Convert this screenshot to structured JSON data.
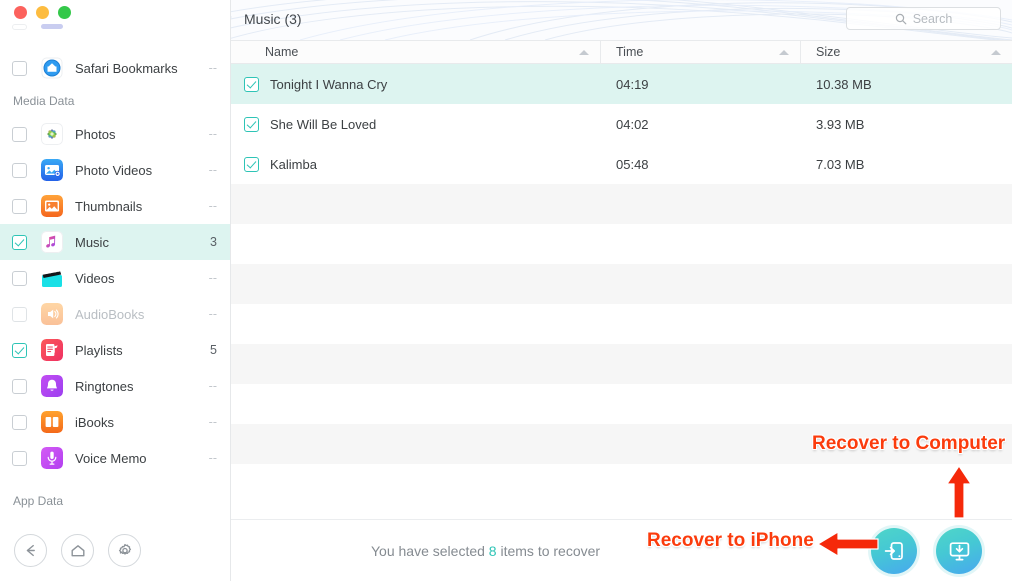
{
  "window": {
    "traffic_lights": [
      "close",
      "minimize",
      "maximize"
    ]
  },
  "sidebar": {
    "groups": [
      {
        "label": "",
        "items": [
          {
            "label": "Safari Bookmarks",
            "icon": "safari-bookmarks-icon",
            "count": "--",
            "checked": false,
            "selected": false,
            "dimmed": false
          }
        ]
      },
      {
        "label": "Media Data",
        "items": [
          {
            "label": "Photos",
            "icon": "photos-icon",
            "count": "--",
            "checked": false,
            "selected": false,
            "dimmed": false
          },
          {
            "label": "Photo Videos",
            "icon": "photo-videos-icon",
            "count": "--",
            "checked": false,
            "selected": false,
            "dimmed": false
          },
          {
            "label": "Thumbnails",
            "icon": "thumbnails-icon",
            "count": "--",
            "checked": false,
            "selected": false,
            "dimmed": false
          },
          {
            "label": "Music",
            "icon": "music-icon",
            "count": "3",
            "checked": true,
            "selected": true,
            "dimmed": false
          },
          {
            "label": "Videos",
            "icon": "videos-icon",
            "count": "--",
            "checked": false,
            "selected": false,
            "dimmed": false
          },
          {
            "label": "AudioBooks",
            "icon": "audiobooks-icon",
            "count": "--",
            "checked": false,
            "selected": false,
            "dimmed": true
          },
          {
            "label": "Playlists",
            "icon": "playlists-icon",
            "count": "5",
            "checked": true,
            "selected": false,
            "dimmed": false
          },
          {
            "label": "Ringtones",
            "icon": "ringtones-icon",
            "count": "--",
            "checked": false,
            "selected": false,
            "dimmed": false
          },
          {
            "label": "iBooks",
            "icon": "ibooks-icon",
            "count": "--",
            "checked": false,
            "selected": false,
            "dimmed": false
          },
          {
            "label": "Voice Memo",
            "icon": "voice-memo-icon",
            "count": "--",
            "checked": false,
            "selected": false,
            "dimmed": false
          }
        ]
      },
      {
        "label": "App Data",
        "items": []
      }
    ],
    "toolbar": [
      {
        "name": "back-button",
        "icon": "arrow-left-icon"
      },
      {
        "name": "home-button",
        "icon": "home-icon"
      },
      {
        "name": "settings-button",
        "icon": "gear-icon"
      }
    ]
  },
  "main": {
    "title": "Music (3)",
    "search": {
      "placeholder": "Search",
      "value": "",
      "icon": "search-icon"
    },
    "table": {
      "columns": [
        {
          "key": "name",
          "label": "Name",
          "sort": "asc"
        },
        {
          "key": "time",
          "label": "Time",
          "sort": "asc"
        },
        {
          "key": "size",
          "label": "Size",
          "sort": "asc"
        }
      ],
      "rows": [
        {
          "checked": true,
          "name": "Tonight I Wanna Cry",
          "time": "04:19",
          "size": "10.38 MB",
          "selected": true
        },
        {
          "checked": true,
          "name": "She Will Be Loved",
          "time": "04:02",
          "size": "3.93 MB",
          "selected": false
        },
        {
          "checked": true,
          "name": "Kalimba",
          "time": "05:48",
          "size": "7.03 MB",
          "selected": false
        }
      ],
      "empty_row_count": 7
    },
    "footer": {
      "status_prefix": "You have selected ",
      "status_count": "8",
      "status_suffix": " items to recover",
      "actions": [
        {
          "name": "recover-to-iphone-button",
          "icon": "phone-import-icon"
        },
        {
          "name": "recover-to-computer-button",
          "icon": "computer-download-icon"
        }
      ]
    }
  },
  "annotations": [
    {
      "name": "annotation-recover-to-computer",
      "text": "Recover to Computer"
    },
    {
      "name": "annotation-recover-to-iphone",
      "text": "Recover to iPhone"
    }
  ],
  "colors": {
    "accent_teal": "#2ec4b6",
    "selection_bg": "#ddf4f0",
    "annotation_red": "#fb3b0c",
    "stripe": "#f6f6f6"
  }
}
